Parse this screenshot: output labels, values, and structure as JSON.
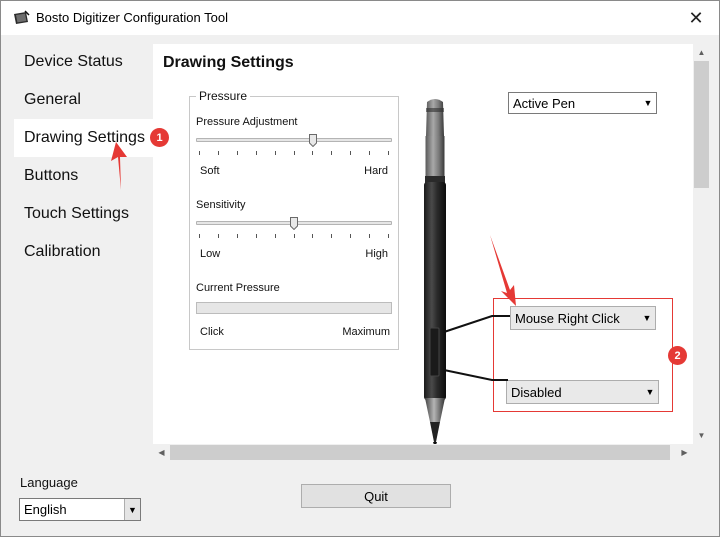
{
  "window": {
    "title": "Bosto Digitizer Configuration Tool"
  },
  "sidebar": {
    "items": [
      {
        "label": "Device Status",
        "active": false
      },
      {
        "label": "General",
        "active": false
      },
      {
        "label": "Drawing Settings",
        "active": true
      },
      {
        "label": "Buttons",
        "active": false
      },
      {
        "label": "Touch Settings",
        "active": false
      },
      {
        "label": "Calibration",
        "active": false
      }
    ]
  },
  "content": {
    "page_title": "Drawing Settings",
    "pressure_group": {
      "legend": "Pressure",
      "pressure_adjustment": {
        "label": "Pressure Adjustment",
        "min_label": "Soft",
        "max_label": "Hard",
        "value_fraction": 0.6,
        "tick_count": 11
      },
      "sensitivity": {
        "label": "Sensitivity",
        "min_label": "Low",
        "max_label": "High",
        "value_fraction": 0.5,
        "tick_count": 11
      },
      "current_pressure": {
        "label": "Current Pressure",
        "min_label": "Click",
        "max_label": "Maximum",
        "value_fraction": 0
      }
    },
    "pen_mode_select": {
      "value": "Active Pen"
    },
    "upper_button_select": {
      "value": "Mouse Right Click"
    },
    "lower_button_select": {
      "value": "Disabled"
    }
  },
  "footer": {
    "language_label": "Language",
    "language_select": {
      "value": "English"
    },
    "quit_label": "Quit"
  },
  "annotations": {
    "badge_1": "1",
    "badge_2": "2",
    "color": "#e53935"
  },
  "icons": {
    "app": "tablet-pen-icon",
    "close": "close-icon",
    "dropdown": "chevron-down-icon"
  }
}
